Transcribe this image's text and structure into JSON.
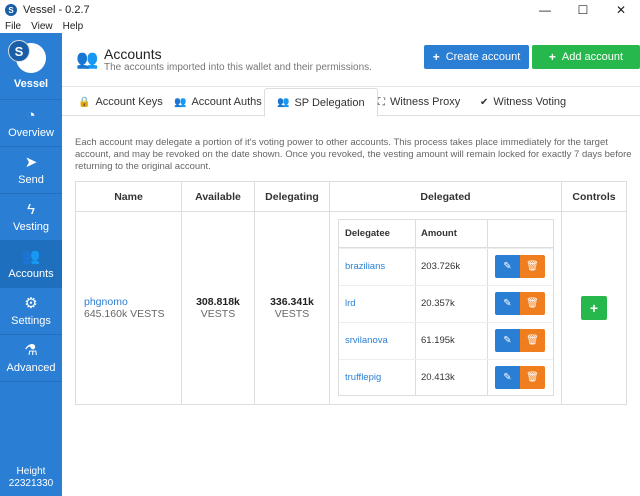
{
  "window": {
    "title": "Vessel - 0.2.7",
    "minimize": "—",
    "maximize": "☐",
    "close": "✕"
  },
  "menu": [
    "File",
    "View",
    "Help"
  ],
  "sidebar": {
    "brand": "Vessel",
    "items": [
      {
        "label": "Overview",
        "icon": "dashboard-icon",
        "glyph": "◔"
      },
      {
        "label": "Send",
        "icon": "paper-plane-icon",
        "glyph": "➤"
      },
      {
        "label": "Vesting",
        "icon": "lightning-icon",
        "glyph": "ϟ"
      },
      {
        "label": "Accounts",
        "icon": "users-icon",
        "glyph": "👥"
      },
      {
        "label": "Settings",
        "icon": "gears-icon",
        "glyph": "⚙"
      },
      {
        "label": "Advanced",
        "icon": "flask-icon",
        "glyph": "⚗"
      }
    ],
    "height_label": "Height",
    "height_value": "22321330"
  },
  "header": {
    "title": "Accounts",
    "subtitle": "The accounts imported into this wallet and their permissions.",
    "create_label": "Create account",
    "add_label": "Add account"
  },
  "tabs": [
    {
      "label": "Account Keys",
      "icon": "lock-icon",
      "glyph": "🔒"
    },
    {
      "label": "Account Auths",
      "icon": "users-icon",
      "glyph": "👥"
    },
    {
      "label": "SP Delegation",
      "icon": "users-icon",
      "glyph": "👥"
    },
    {
      "label": "Witness Proxy",
      "icon": "sitemap-icon",
      "glyph": "⛶"
    },
    {
      "label": "Witness Voting",
      "icon": "check-icon",
      "glyph": "✔"
    }
  ],
  "description": "Each account may delegate a portion of it's voting power to other accounts. This process takes place immediately for the target account, and may be revoked on the date shown. Once you revoked, the vesting amount will remain locked for exactly 7 days before returning to the original account.",
  "table": {
    "headers": {
      "name": "Name",
      "available": "Available",
      "delegating": "Delegating",
      "delegated": "Delegated",
      "controls": "Controls"
    },
    "row": {
      "name": "phgnomo",
      "name_sub": "645.160k VESTS",
      "available": "308.818k",
      "available_unit": "VESTS",
      "delegating": "336.341k",
      "delegating_unit": "VESTS"
    },
    "inner_headers": {
      "delegatee": "Delegatee",
      "amount": "Amount"
    },
    "delegations": [
      {
        "delegatee": "brazilians",
        "amount": "203.726k"
      },
      {
        "delegatee": "lrd",
        "amount": "20.357k"
      },
      {
        "delegatee": "srvilanova",
        "amount": "61.195k"
      },
      {
        "delegatee": "trufflepig",
        "amount": "20.413k"
      }
    ]
  },
  "colors": {
    "primary": "#2a7fd4",
    "success": "#27b84d",
    "warning": "#f07d1e"
  }
}
